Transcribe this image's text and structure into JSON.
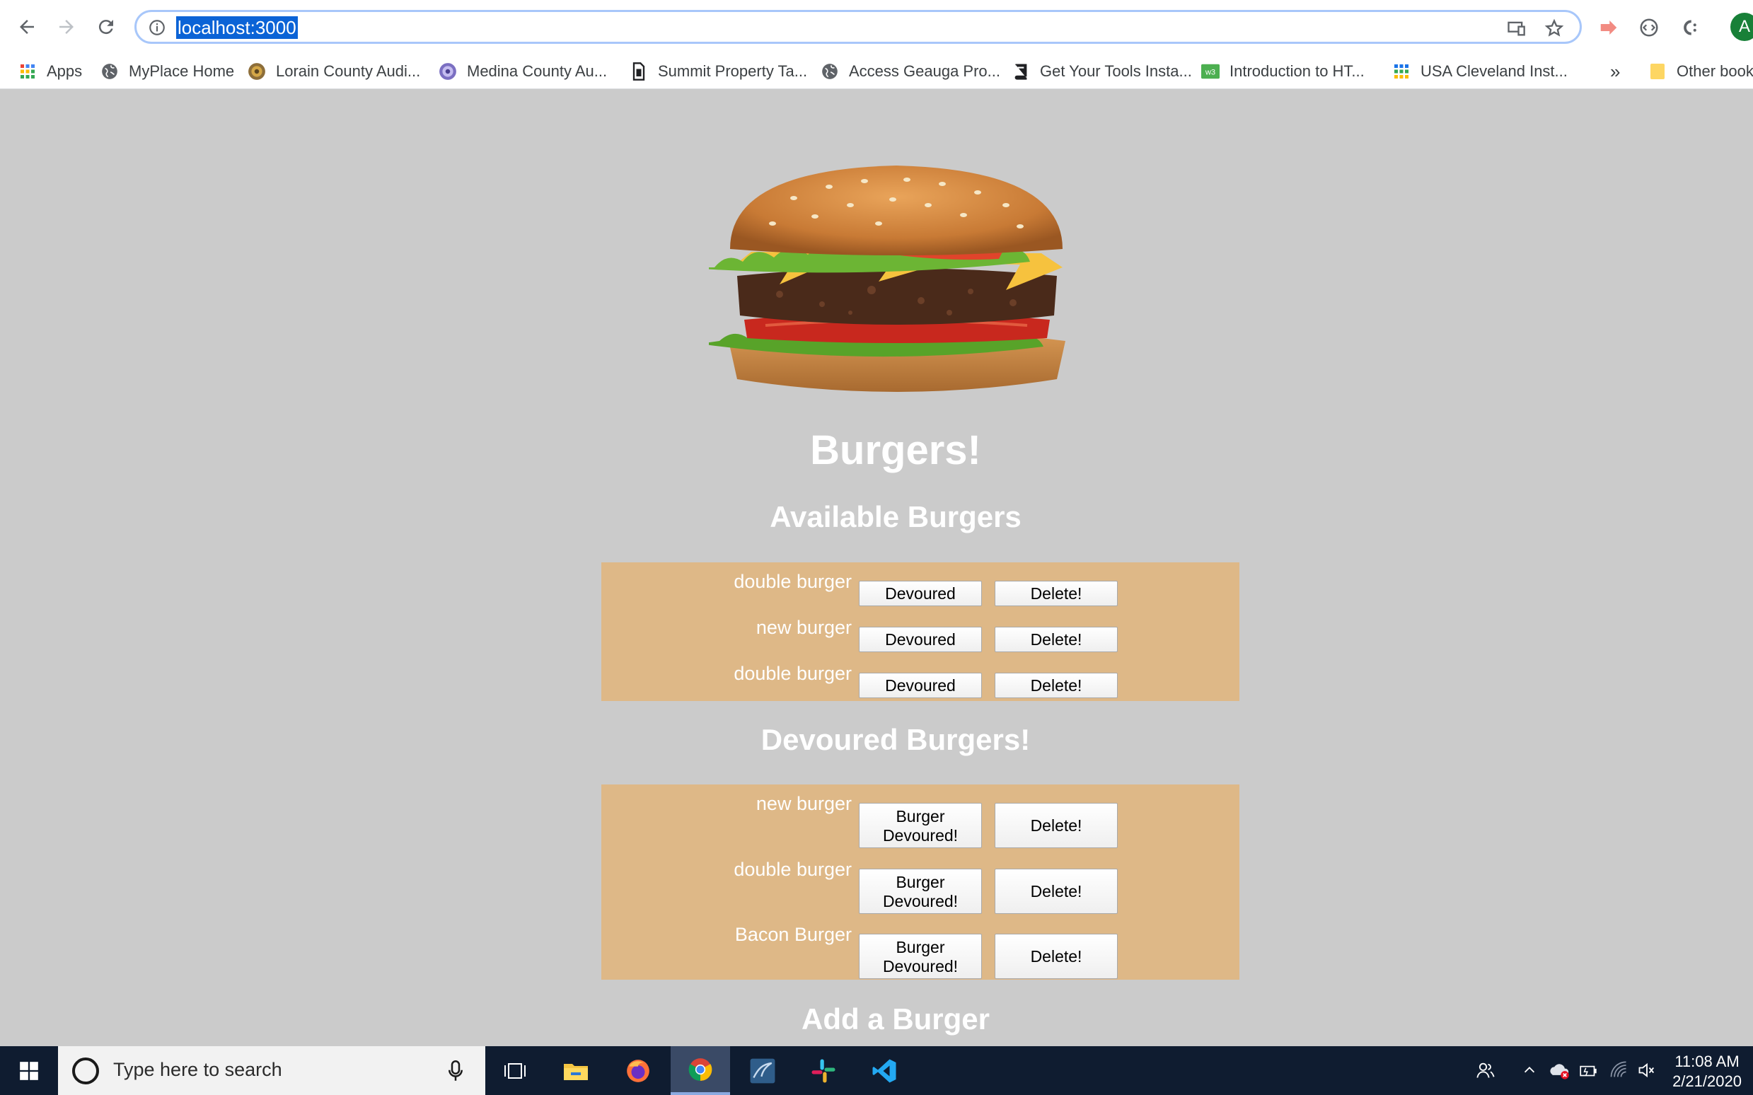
{
  "browser": {
    "url": "localhost:3000",
    "bookmarks": [
      {
        "label": "Apps",
        "icon": "apps-grid-icon"
      },
      {
        "label": "MyPlace Home",
        "icon": "globe-icon"
      },
      {
        "label": "Lorain County Audi...",
        "icon": "seal-icon"
      },
      {
        "label": "Medina County Au...",
        "icon": "seal-icon"
      },
      {
        "label": "Summit Property Ta...",
        "icon": "document-icon"
      },
      {
        "label": "Access Geauga Pro...",
        "icon": "globe-icon"
      },
      {
        "label": "Get Your Tools Insta...",
        "icon": "book-icon"
      },
      {
        "label": "Introduction to HT...",
        "icon": "w3-icon"
      },
      {
        "label": "USA Cleveland Inst...",
        "icon": "grid-icon"
      }
    ],
    "overflow_label": "»",
    "other_bookmarks": "Other book",
    "profile_initial": "A"
  },
  "page": {
    "title": "Burgers!",
    "available_heading": "Available Burgers",
    "available": [
      {
        "name": "double burger",
        "action": "Devoured",
        "delete": "Delete!"
      },
      {
        "name": "new burger",
        "action": "Devoured",
        "delete": "Delete!"
      },
      {
        "name": "double burger",
        "action": "Devoured",
        "delete": "Delete!"
      }
    ],
    "devoured_heading": "Devoured Burgers!",
    "devoured": [
      {
        "name": "new burger",
        "action_line1": "Burger",
        "action_line2": "Devoured!",
        "delete": "Delete!"
      },
      {
        "name": "double burger",
        "action_line1": "Burger",
        "action_line2": "Devoured!",
        "delete": "Delete!"
      },
      {
        "name": "Bacon Burger",
        "action_line1": "Burger",
        "action_line2": "Devoured!",
        "delete": "Delete!"
      }
    ],
    "add_heading": "Add a Burger",
    "panel_color": "#deb887",
    "background_color": "#cbcbcb"
  },
  "taskbar": {
    "search_placeholder": "Type here to search",
    "time": "11:08 AM",
    "date": "2/21/2020",
    "apps": [
      "task-view-icon",
      "file-explorer-icon",
      "firefox-icon",
      "chrome-icon",
      "mysql-workbench-icon",
      "slack-icon",
      "vscode-icon"
    ]
  }
}
